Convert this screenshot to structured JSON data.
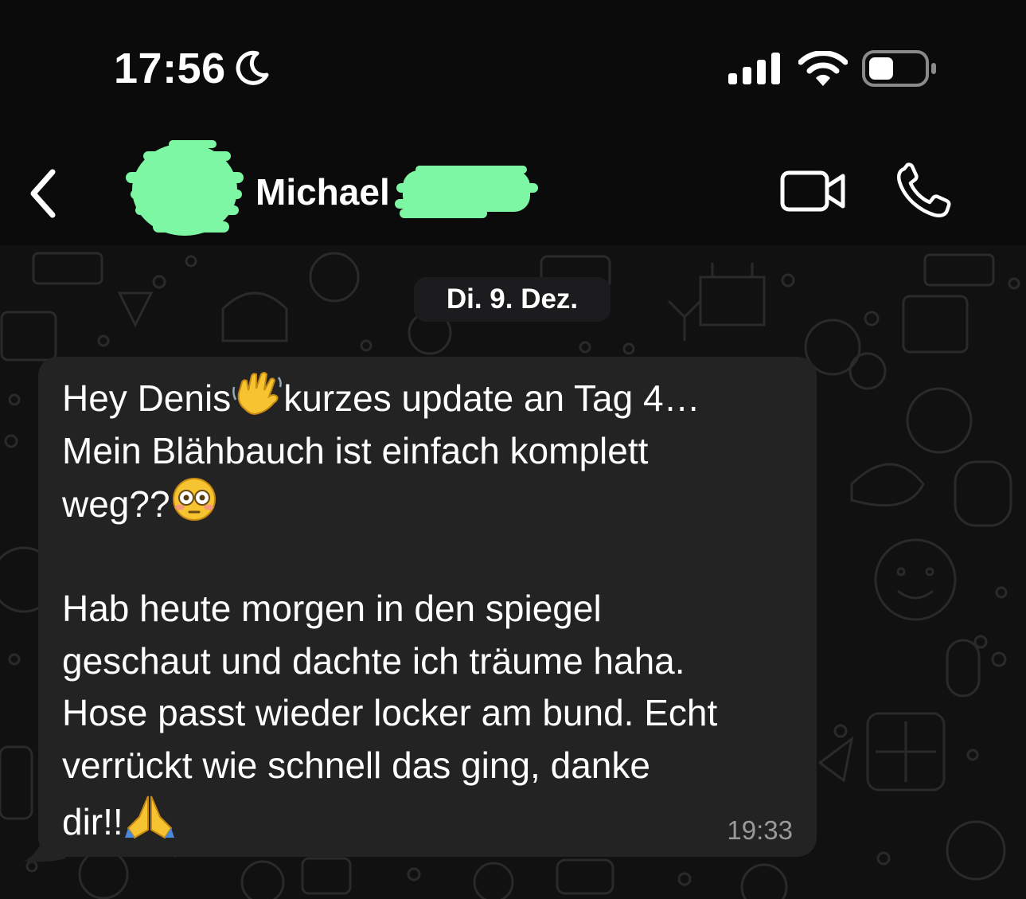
{
  "status_bar": {
    "time": "17:56",
    "focus_icon": "moon-icon",
    "signal_icon": "cellular-signal-icon",
    "wifi_icon": "wifi-icon",
    "battery_icon": "battery-icon",
    "battery_level": 0.45
  },
  "header": {
    "back_icon": "chevron-left-icon",
    "contact_name": "Michael",
    "video_icon": "video-camera-icon",
    "phone_icon": "phone-icon",
    "redaction_color": "#7df7a4"
  },
  "chat": {
    "date_label": "Di. 9. Dez.",
    "message": {
      "line1_a": "Hey Denis",
      "line1_emoji": "waving-hand-emoji",
      "line1_b": "kurzes update an Tag 4…",
      "line2": "Mein Blähbauch ist einfach komplett",
      "line3_a": "weg??",
      "line3_emoji": "flushed-face-emoji",
      "para2_line1": "Hab heute morgen in den spiegel",
      "para2_line2": "geschaut und dachte ich träume haha.",
      "para2_line3": "Hose passt wieder locker am bund. Echt",
      "para2_line4": "verrückt wie schnell das ging, danke",
      "para2_line5": "dir!!",
      "last_emoji": "folded-hands-emoji",
      "time": "19:33"
    }
  },
  "colors": {
    "background": "#0b0b0b",
    "chat_background": "#111111",
    "bubble": "#232323",
    "timestamp": "#9a9a9a"
  }
}
